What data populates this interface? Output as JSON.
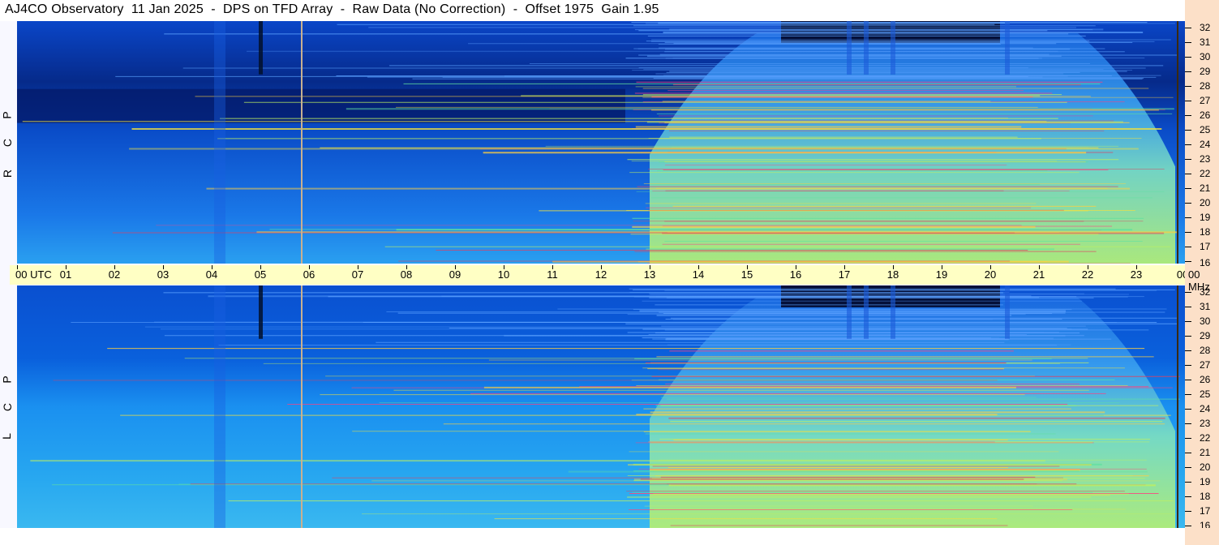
{
  "title": "AJ4CO Observatory  11 Jan 2025  -  DPS on TFD Array  -  Raw Data (No Correction)  -  Offset 1975  Gain 1.95",
  "colors": {
    "panel_bg": "#0a55d8",
    "utc_bar": "#ffffc4",
    "freq_axis": "#fce0c8",
    "marker_line": "#c8b090"
  },
  "chart_data": [
    {
      "type": "heatmap",
      "panel": "RCP",
      "polarization_label": [
        "R",
        "C",
        "P"
      ],
      "x": {
        "label": "UTC",
        "ticks": [
          "00",
          "01",
          "02",
          "03",
          "04",
          "05",
          "06",
          "07",
          "08",
          "09",
          "10",
          "11",
          "12",
          "13",
          "14",
          "15",
          "16",
          "17",
          "18",
          "19",
          "20",
          "21",
          "22",
          "23",
          "00"
        ],
        "range": [
          0,
          24
        ]
      },
      "y": {
        "label": "MHz",
        "ticks": [
          "16",
          "17",
          "18",
          "19",
          "20",
          "21",
          "22",
          "23",
          "24",
          "25",
          "26",
          "27",
          "28",
          "29",
          "30",
          "31",
          "32"
        ],
        "range": [
          16,
          32
        ]
      },
      "markers_utc": [
        5.85,
        23.85
      ]
    },
    {
      "type": "heatmap",
      "panel": "LCP",
      "polarization_label": [
        "L",
        "C",
        "P"
      ],
      "x": {
        "label": "UTC",
        "ticks": [
          "00",
          "01",
          "02",
          "03",
          "04",
          "05",
          "06",
          "07",
          "08",
          "09",
          "10",
          "11",
          "12",
          "13",
          "14",
          "15",
          "16",
          "17",
          "18",
          "19",
          "20",
          "21",
          "22",
          "23",
          "00"
        ],
        "range": [
          0,
          24
        ]
      },
      "y": {
        "label": "MHz",
        "ticks": [
          "16",
          "17",
          "18",
          "19",
          "20",
          "21",
          "22",
          "23",
          "24",
          "25",
          "26",
          "27",
          "28",
          "29",
          "30",
          "31",
          "32"
        ],
        "range": [
          16,
          32
        ]
      },
      "markers_utc": [
        5.85,
        23.85
      ]
    }
  ],
  "axis": {
    "utc_first_label": "00  UTC",
    "mhz_label": "00 MHz"
  }
}
